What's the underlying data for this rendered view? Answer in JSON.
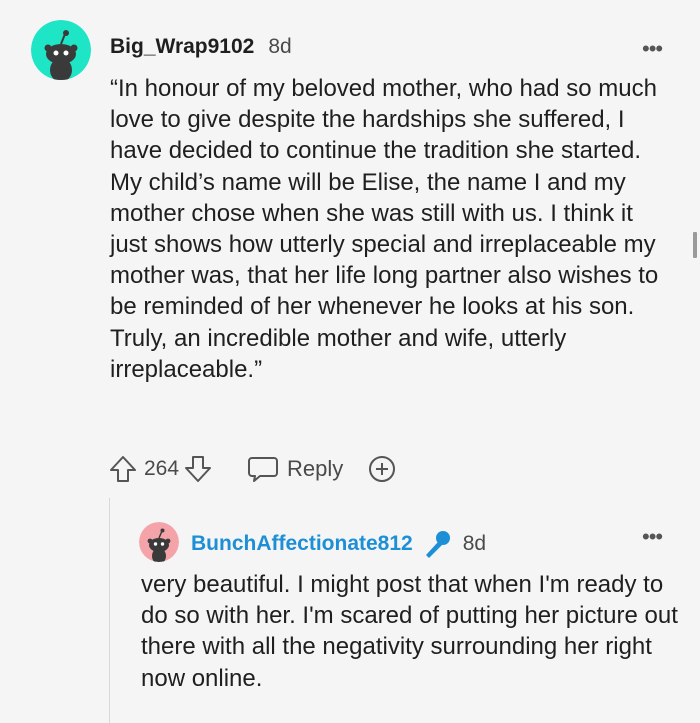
{
  "top_comment": {
    "username": "Big_Wrap9102",
    "age": "8d",
    "more_icon": "more-horizontal-icon",
    "avatar_color": "#1fe5c7",
    "text": "“In honour of my beloved mother, who had so much love to give despite the hardships she suffered, I have decided to continue the tradition she started. My child’s name will be Elise, the name I and my mother chose when she was still with us. I think it just shows how utterly special and irreplaceable my mother was, that her life long partner also wishes to be reminded of her whenever he looks at his son. Truly, an incredible mother and wife, utterly irreplaceable.”",
    "score": "264",
    "reply_label": "Reply",
    "icons": [
      "upvote-icon",
      "downvote-icon",
      "reply-icon",
      "award-icon"
    ]
  },
  "reply_comment": {
    "username": "BunchAffectionate812",
    "age": "8d",
    "more_icon": "more-horizontal-icon",
    "avatar_color": "#f4a3a8",
    "flair_icon": "microphone-icon",
    "accent_color": "#1d8fd6",
    "text": "very beautiful. I might post that when I'm ready to do so with her. I'm scared of putting her picture out there with all the negativity surrounding her right now online."
  }
}
